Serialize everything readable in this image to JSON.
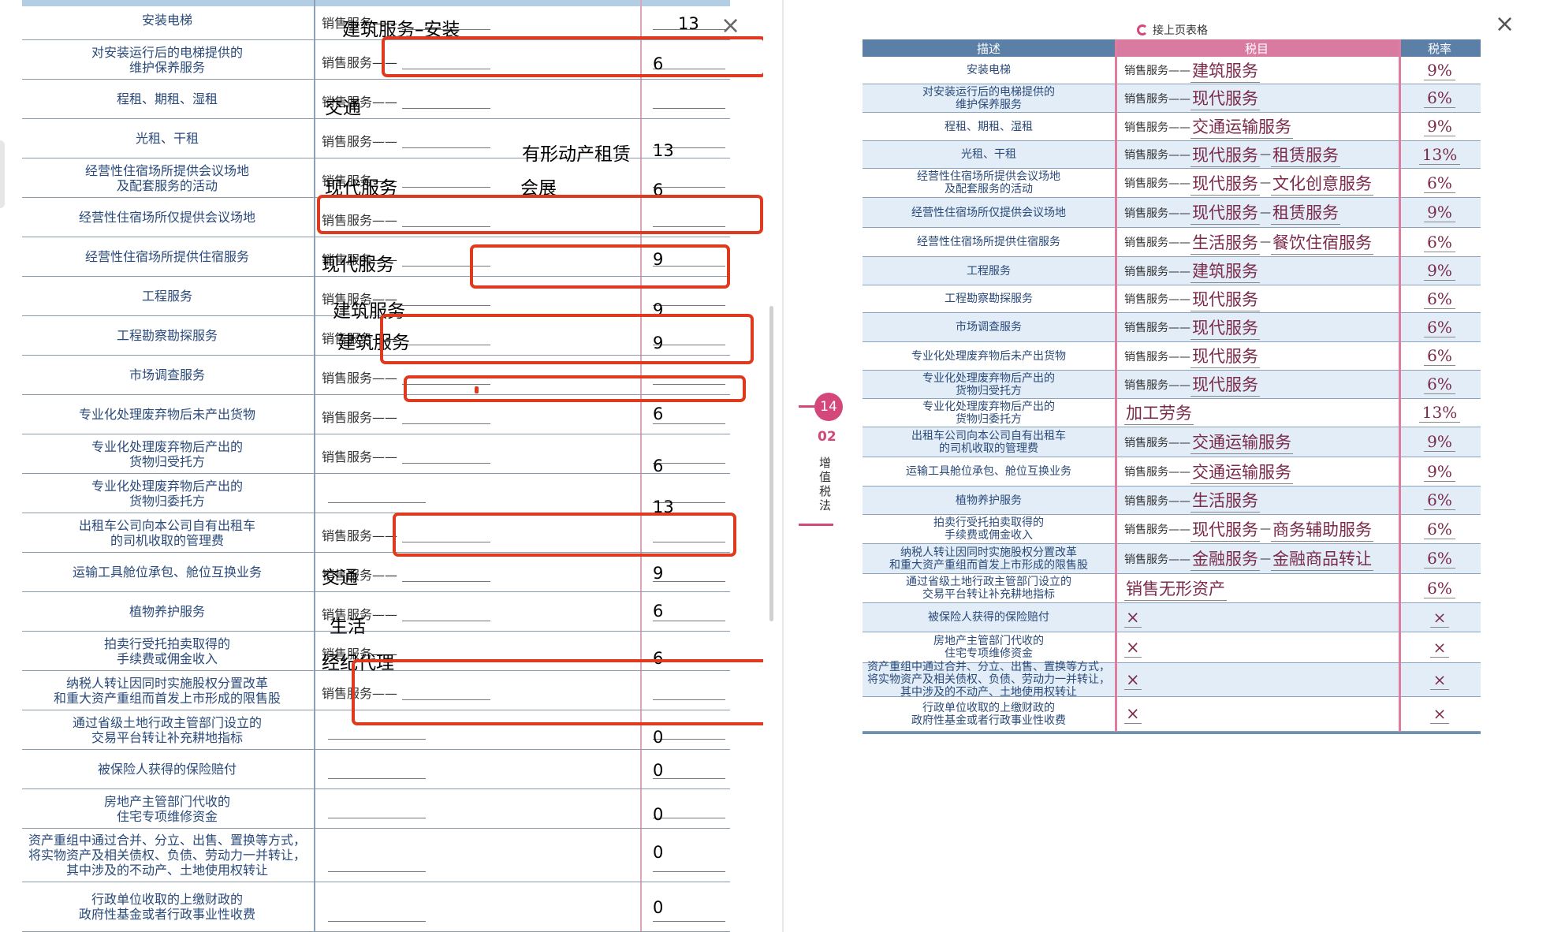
{
  "left": {
    "close_icon": "×",
    "rows": [
      {
        "desc": "安装电梯",
        "prefix": "销售服务——",
        "answer": "建筑服务–安装",
        "rate": "13"
      },
      {
        "desc": "对安装运行后的电梯提供的\n维护保养服务",
        "prefix": "销售服务——",
        "answer": "",
        "rate": "6"
      },
      {
        "desc": "程租、期租、湿租",
        "prefix": "销售服务——",
        "answer": "交通",
        "rate": ""
      },
      {
        "desc": "光租、干租",
        "prefix": "销售服务——",
        "answer": "有形动产租赁",
        "rate": "13"
      },
      {
        "desc": "经营性住宿场所提供会议场地\n及配套服务的活动",
        "prefix": "销售服务——",
        "answer": "现代服务",
        "answer2": "会展",
        "rate": "6"
      },
      {
        "desc": "经营性住宿场所仅提供会议场地",
        "prefix": "销售服务——",
        "answer": "",
        "rate": ""
      },
      {
        "desc": "经营性住宿场所提供住宿服务",
        "prefix": "销售服务——",
        "answer": "现代服务",
        "rate": "9"
      },
      {
        "desc": "工程服务",
        "prefix": "销售服务——",
        "answer": "建筑服务",
        "rate": "9"
      },
      {
        "desc": "工程勘察勘探服务",
        "prefix": "销售服务——",
        "answer": "建筑服务",
        "rate": "9"
      },
      {
        "desc": "市场调查服务",
        "prefix": "销售服务——",
        "answer": "",
        "rate": ""
      },
      {
        "desc": "专业化处理废弃物后未产出货物",
        "prefix": "销售服务——",
        "answer": "",
        "rate": "6"
      },
      {
        "desc": "专业化处理废弃物后产出的\n货物归受托方",
        "prefix": "销售服务——",
        "answer": "",
        "rate": "6"
      },
      {
        "desc": "专业化处理废弃物后产出的\n货物归委托方",
        "prefix": "",
        "answer": "",
        "rate": "13"
      },
      {
        "desc": "出租车公司向本公司自有出租车\n的司机收取的管理费",
        "prefix": "销售服务——",
        "answer": "",
        "rate": ""
      },
      {
        "desc": "运输工具舱位承包、舱位互换业务",
        "prefix": "销售服务——",
        "answer": "交通",
        "rate": "9"
      },
      {
        "desc": "植物养护服务",
        "prefix": "销售服务——",
        "answer": "生活",
        "rate": "6"
      },
      {
        "desc": "拍卖行受托拍卖取得的\n手续费或佣金收入",
        "prefix": "销售服务——",
        "answer": "经纪代理",
        "rate": "6"
      },
      {
        "desc": "纳税人转让因同时实施股权分置改革\n和重大资产重组而首发上市形成的限售股",
        "prefix": "销售服务——",
        "answer": "",
        "rate": ""
      },
      {
        "desc": "通过省级土地行政主管部门设立的\n交易平台转让补充耕地指标",
        "prefix": "",
        "answer": "",
        "rate": "0"
      },
      {
        "desc": "被保险人获得的保险赔付",
        "prefix": "",
        "answer": "",
        "rate": "0"
      },
      {
        "desc": "房地产主管部门代收的\n住宅专项维修资金",
        "prefix": "",
        "answer": "",
        "rate": "0"
      },
      {
        "desc": "资产重组中通过合并、分立、出售、置换等方式，\n将实物资产及相关债权、负债、劳动力一并转让，\n其中涉及的不动产、土地使用权转让",
        "prefix": "",
        "answer": "",
        "rate": "0"
      },
      {
        "desc": "行政单位收取的上缴财政的\n政府性基金或者行政事业性收费",
        "prefix": "",
        "answer": "",
        "rate": "0"
      }
    ]
  },
  "side_tab": {
    "page": "14",
    "chapter": "02",
    "title": "增值税法"
  },
  "right": {
    "close_icon": "×",
    "continued": "接上页表格",
    "headers": [
      "描述",
      "税目",
      "税率"
    ],
    "rows": [
      {
        "desc": "安装电梯",
        "prefix": "销售服务——",
        "a": "建筑服务",
        "b": "",
        "rate": "9%"
      },
      {
        "desc": "对安装运行后的电梯提供的\n维护保养服务",
        "prefix": "销售服务——",
        "a": "现代服务",
        "b": "",
        "rate": "6%"
      },
      {
        "desc": "程租、期租、湿租",
        "prefix": "销售服务——",
        "a": "交通运输服务",
        "b": "",
        "rate": "9%"
      },
      {
        "desc": "光租、干租",
        "prefix": "销售服务——",
        "a": "现代服务",
        "b": "租赁服务",
        "rate": "13%"
      },
      {
        "desc": "经营性住宿场所提供会议场地\n及配套服务的活动",
        "prefix": "销售服务——",
        "a": "现代服务",
        "b": "文化创意服务",
        "rate": "6%"
      },
      {
        "desc": "经营性住宿场所仅提供会议场地",
        "prefix": "销售服务——",
        "a": "现代服务",
        "b": "租赁服务",
        "rate": "9%"
      },
      {
        "desc": "经营性住宿场所提供住宿服务",
        "prefix": "销售服务——",
        "a": "生活服务",
        "b": "餐饮住宿服务",
        "rate": "6%"
      },
      {
        "desc": "工程服务",
        "prefix": "销售服务——",
        "a": "建筑服务",
        "b": "",
        "rate": "9%"
      },
      {
        "desc": "工程勘察勘探服务",
        "prefix": "销售服务——",
        "a": "现代服务",
        "b": "",
        "rate": "6%"
      },
      {
        "desc": "市场调查服务",
        "prefix": "销售服务——",
        "a": "现代服务",
        "b": "",
        "rate": "6%"
      },
      {
        "desc": "专业化处理废弃物后未产出货物",
        "prefix": "销售服务——",
        "a": "现代服务",
        "b": "",
        "rate": "6%"
      },
      {
        "desc": "专业化处理废弃物后产出的\n货物归受托方",
        "prefix": "销售服务——",
        "a": "现代服务",
        "b": "",
        "rate": "6%"
      },
      {
        "desc": "专业化处理废弃物后产出的\n货物归委托方",
        "prefix": "",
        "a": "加工劳务",
        "b": "",
        "rate": "13%"
      },
      {
        "desc": "出租车公司向本公司自有出租车\n的司机收取的管理费",
        "prefix": "销售服务——",
        "a": "交通运输服务",
        "b": "",
        "rate": "9%"
      },
      {
        "desc": "运输工具舱位承包、舱位互换业务",
        "prefix": "销售服务——",
        "a": "交通运输服务",
        "b": "",
        "rate": "9%"
      },
      {
        "desc": "植物养护服务",
        "prefix": "销售服务——",
        "a": "生活服务",
        "b": "",
        "rate": "6%"
      },
      {
        "desc": "拍卖行受托拍卖取得的\n手续费或佣金收入",
        "prefix": "销售服务——",
        "a": "现代服务",
        "b": "商务辅助服务",
        "rate": "6%"
      },
      {
        "desc": "纳税人转让因同时实施股权分置改革\n和重大资产重组而首发上市形成的限售股",
        "prefix": "销售服务——",
        "a": "金融服务",
        "b": "金融商品转让",
        "rate": "6%"
      },
      {
        "desc": "通过省级土地行政主管部门设立的\n交易平台转让补充耕地指标",
        "prefix": "",
        "a": "销售无形资产",
        "b": "",
        "rate": "6%"
      },
      {
        "desc": "被保险人获得的保险赔付",
        "prefix": "",
        "a": "×",
        "b": "",
        "rate": "×"
      },
      {
        "desc": "房地产主管部门代收的\n住宅专项维修资金",
        "prefix": "",
        "a": "×",
        "b": "",
        "rate": "×"
      },
      {
        "desc": "资产重组中通过合并、分立、出售、置换等方式，\n将实物资产及相关债权、负债、劳动力一并转让，\n其中涉及的不动产、土地使用权转让",
        "prefix": "",
        "a": "×",
        "b": "",
        "rate": "×"
      },
      {
        "desc": "行政单位收取的上缴财政的\n政府性基金或者行政事业性收费",
        "prefix": "",
        "a": "×",
        "b": "",
        "rate": "×"
      }
    ]
  },
  "colors": {
    "accent": "#d4477a",
    "header_blue": "#5b7fa6",
    "header_pink": "#d97aa0",
    "red_box": "#e03a1e"
  }
}
